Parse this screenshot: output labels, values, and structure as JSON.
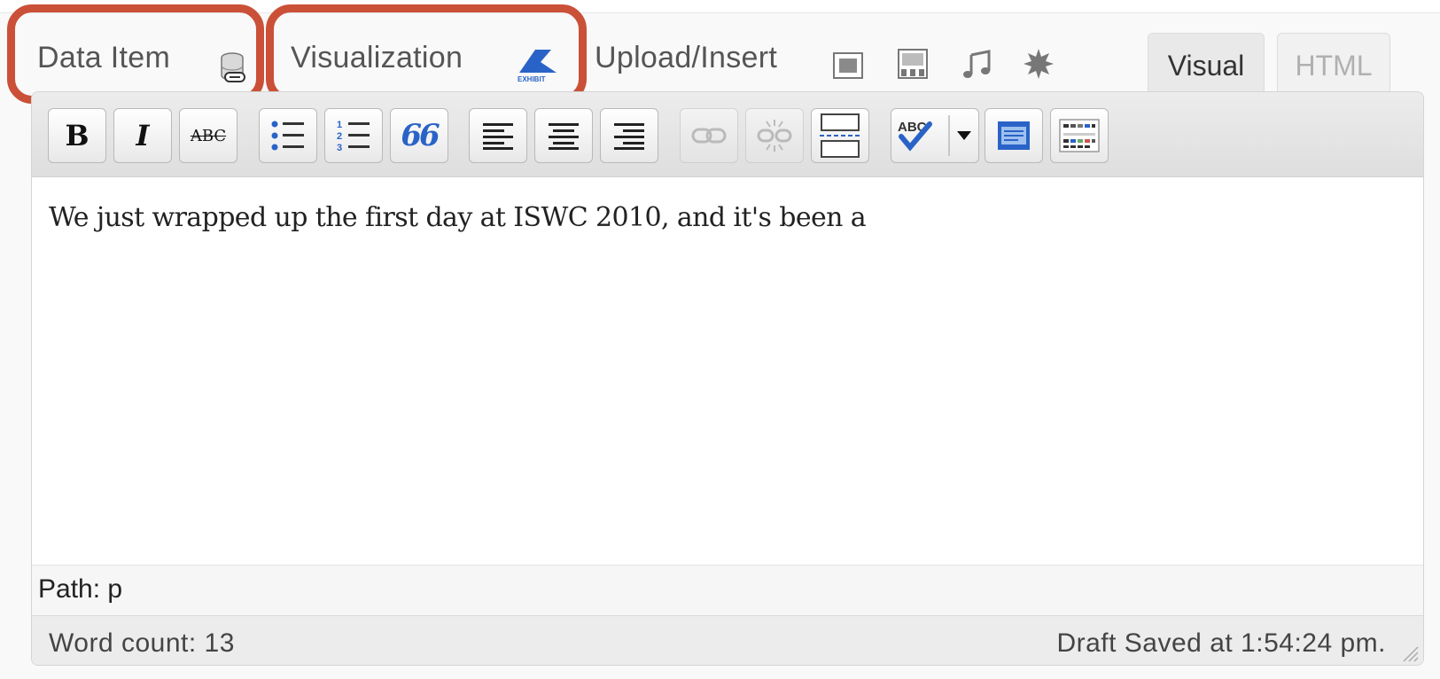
{
  "media_bar": {
    "data_item_label": "Data Item",
    "visualization_label": "Visualization",
    "visualization_icon_text": "EXHIBIT",
    "upload_insert_label": "Upload/Insert",
    "icons": [
      "database-link-icon",
      "exhibit-icon",
      "add-image-icon",
      "add-video-icon",
      "add-audio-icon",
      "add-media-icon"
    ]
  },
  "editor_tabs": {
    "visual": "Visual",
    "html": "HTML"
  },
  "toolbar": {
    "buttons": [
      {
        "name": "bold",
        "glyph": "B"
      },
      {
        "name": "italic",
        "glyph": "I"
      },
      {
        "name": "strikethrough",
        "glyph": "ABC"
      },
      {
        "name": "bulleted-list"
      },
      {
        "name": "numbered-list",
        "glyph_numbers": [
          "1",
          "2",
          "3"
        ]
      },
      {
        "name": "blockquote",
        "glyph": "66"
      },
      {
        "name": "align-left"
      },
      {
        "name": "align-center"
      },
      {
        "name": "align-right"
      },
      {
        "name": "insert-link",
        "disabled": true
      },
      {
        "name": "unlink",
        "disabled": true
      },
      {
        "name": "insert-more"
      },
      {
        "name": "spellcheck",
        "glyph": "ABC"
      },
      {
        "name": "fullscreen"
      },
      {
        "name": "kitchen-sink"
      }
    ]
  },
  "content": {
    "text": "We just wrapped up the first day at ISWC 2010, and it's been a"
  },
  "path_bar": {
    "text": "Path: p"
  },
  "status": {
    "word_count": "Word count: 13",
    "draft_saved": "Draft Saved at 1:54:24 pm."
  },
  "colors": {
    "highlight": "#cb5038",
    "icon_blue": "#2a63c7",
    "background": "#f9f9f9"
  }
}
